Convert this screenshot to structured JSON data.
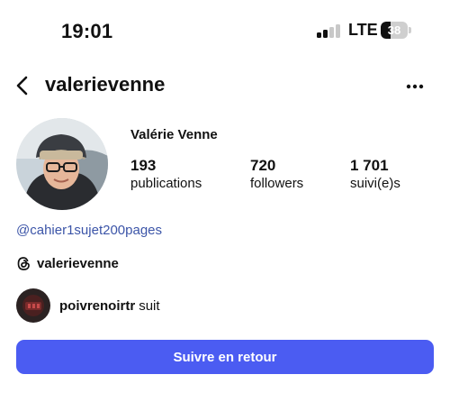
{
  "status_bar": {
    "time": "19:01",
    "network": "LTE",
    "battery": 38,
    "battery_label": "38",
    "signal_bars_active": 2,
    "signal_bars_total": 4
  },
  "nav": {
    "back_icon": "chevron-left-icon",
    "username": "valerievenne",
    "more_icon": "ellipsis-icon"
  },
  "profile": {
    "full_name": "Valérie Venne",
    "stats": [
      {
        "value": "193",
        "label": "publications"
      },
      {
        "value": "720",
        "label": "followers"
      },
      {
        "value": "1 701",
        "label": "suivi(e)s"
      }
    ],
    "link": "@cahier1sujet200pages",
    "threads": {
      "icon": "threads-icon",
      "handle": "valerievenne"
    }
  },
  "followed_by": {
    "name": "poivrenoirtr",
    "suffix": "suit"
  },
  "actions": {
    "follow_back_label": "Suivre en retour"
  },
  "colors": {
    "accent": "#4b5cf2",
    "link": "#3c55a8",
    "text": "#111111"
  }
}
